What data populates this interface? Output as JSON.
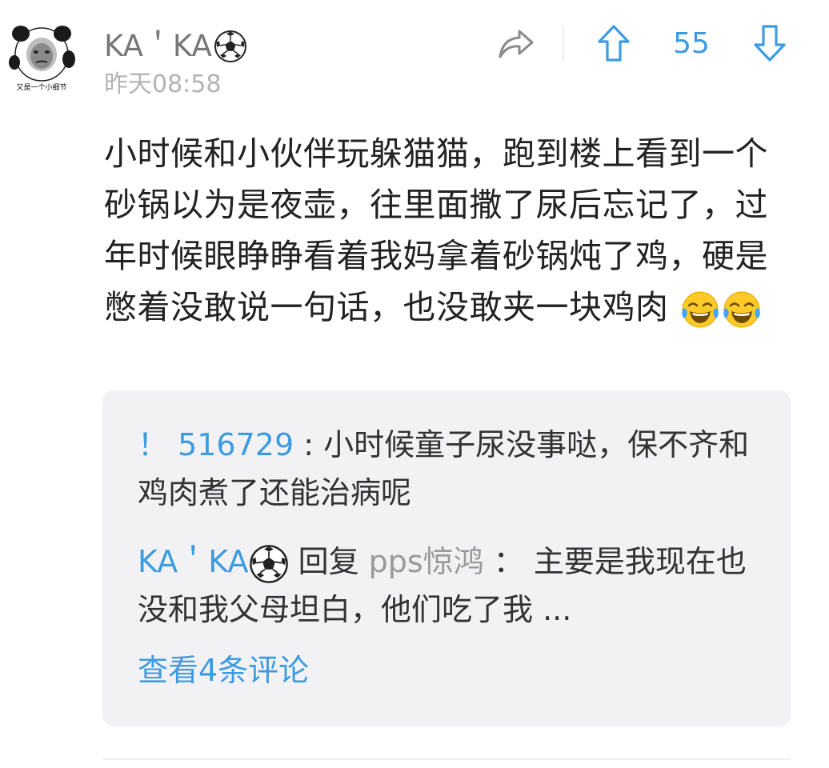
{
  "post": {
    "username": "KA＇KA",
    "username_emoji": "soccer-ball",
    "timestamp": "昨天08:58",
    "avatar_caption": "又是一个小细节",
    "score": "55",
    "content": "小时候和小伙伴玩躲猫猫，跑到楼上看到一个砂锅以为是夜壶，往里面撒了尿后忘记了，过年时候眼睁睁看着我妈拿着砂锅炖了鸡，硬是憋着没敢说一句话，也没敢夹一块鸡肉",
    "content_emojis": [
      "tears-of-joy",
      "tears-of-joy"
    ]
  },
  "replies": {
    "first": {
      "author": "！ 516729",
      "separator": " : ",
      "text": "小时候童子尿没事哒，保不齐和鸡肉煮了还能治病呢"
    },
    "second": {
      "author": "KA＇KA",
      "author_emoji": "soccer-ball",
      "reply_word": " 回复 ",
      "target": "pps惊鸿",
      "separator": " ：",
      "text": " 主要是我现在也没和我父母坦白，他们吃了我 ..."
    },
    "view_more_label": "查看4条评论"
  },
  "colors": {
    "accent_blue": "#3d9be0",
    "username_grey": "#777777",
    "timestamp_grey": "#b3b3b3",
    "card_background": "#f2f2f4"
  }
}
